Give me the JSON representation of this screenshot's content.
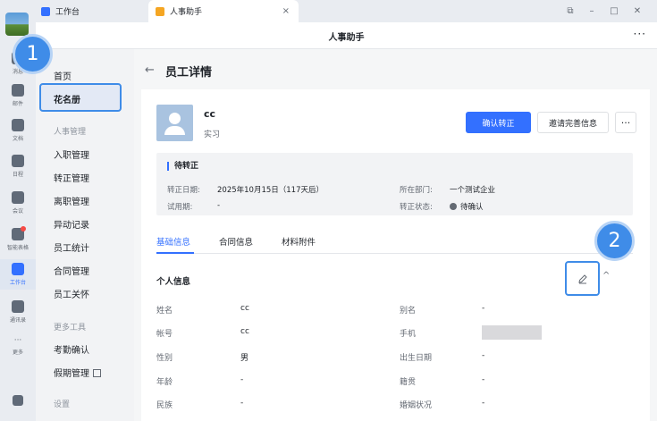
{
  "tabs": {
    "workbench": "工作台",
    "hr_assistant": "人事助手",
    "close": "×"
  },
  "window": {
    "pin": "⧉",
    "minimize": "–",
    "maximize": "□",
    "close": "✕"
  },
  "title_bar": {
    "title": "人事助手",
    "more": "···"
  },
  "rail": {
    "items": [
      {
        "label": "消息"
      },
      {
        "label": "邮件"
      },
      {
        "label": "文档"
      },
      {
        "label": "日程"
      },
      {
        "label": "会议"
      },
      {
        "label": "智能表格"
      },
      {
        "label": "工作台"
      },
      {
        "label": "通讯录"
      },
      {
        "label": "更多"
      }
    ],
    "more_glyph": "···"
  },
  "sidebar": {
    "home": "首页",
    "roster": "花名册",
    "group_hr": "人事管理",
    "onboarding": "入职管理",
    "regularization": "转正管理",
    "offboarding": "离职管理",
    "changes": "异动记录",
    "stats": "员工统计",
    "contracts": "合同管理",
    "care": "员工关怀",
    "group_tools": "更多工具",
    "attendance": "考勤确认",
    "leave": "假期管理",
    "group_settings": "设置"
  },
  "page": {
    "back": "←",
    "title": "员工详情"
  },
  "employee": {
    "name": "cc",
    "status": "实习"
  },
  "actions": {
    "confirm": "确认转正",
    "invite": "邀请完善信息",
    "more": "···"
  },
  "regularization_panel": {
    "title": "待转正",
    "date_label": "转正日期:",
    "date_value": "2025年10月15日（117天后）",
    "probation_label": "试用期:",
    "probation_value": "-",
    "dept_label": "所在部门:",
    "dept_value": "一个测试企业",
    "status_label": "转正状态:",
    "status_value": "待确认"
  },
  "detail_tabs": {
    "basic": "基础信息",
    "contract": "合同信息",
    "attachments": "材料附件"
  },
  "personal": {
    "title": "个人信息",
    "collapse": "^",
    "left": [
      {
        "label": "姓名",
        "value": "cc"
      },
      {
        "label": "帐号",
        "value": "cc"
      },
      {
        "label": "性别",
        "value": "男"
      },
      {
        "label": "年龄",
        "value": "-"
      },
      {
        "label": "民族",
        "value": "-"
      }
    ],
    "right": [
      {
        "label": "别名",
        "value": "-"
      },
      {
        "label": "手机",
        "value": ""
      },
      {
        "label": "出生日期",
        "value": "-"
      },
      {
        "label": "籍贯",
        "value": "-"
      },
      {
        "label": "婚姻状况",
        "value": "-"
      }
    ]
  },
  "callouts": {
    "one": "1",
    "two": "2"
  }
}
